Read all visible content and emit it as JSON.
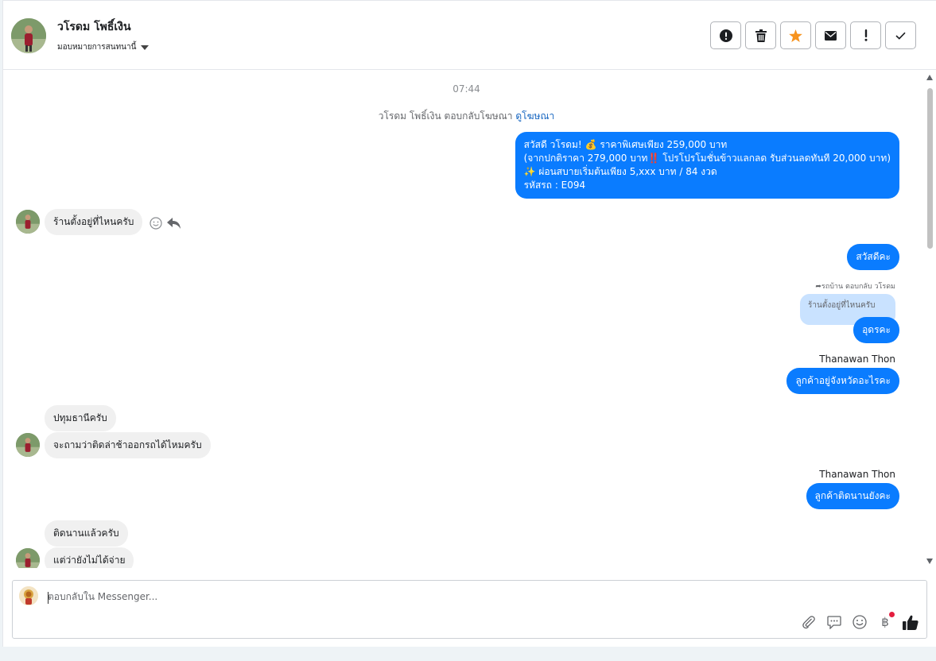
{
  "header": {
    "contact_name": "วโรดม โพธิ์เงิน",
    "assign_label": "มอบหมายการสนทนานี้"
  },
  "toolbar": {
    "buttons": [
      "alert-circle-icon",
      "trash-icon",
      "star-icon",
      "envelope-icon",
      "exclamation-icon",
      "checkmark-icon"
    ]
  },
  "chat": {
    "timestamp": "07:44",
    "ad_reply_text": "วโรดม โพธิ์เงิน ตอบกลับโฆษณา",
    "ad_reply_link": "ดูโฆษณา",
    "messages": [
      {
        "direction": "out",
        "lines": [
          "สวัสดี วโรดม! 💰 ราคาพิเศษเพียง 259,000 บาท",
          "(จากปกติราคา 279,000 บาท‼️ โปรโปรโมชั่นข้าวแลกลด รับส่วนลดทันที 20,000 บาท)",
          "✨ ผ่อนสบายเริ่มต้นเพียง 5,xxx บาท / 84 งวด",
          " รหัสรถ : E094"
        ]
      },
      {
        "direction": "in",
        "text": "ร้านตั้งอยู่ที่ไหนครับ"
      },
      {
        "direction": "out",
        "text": "สวัสดีคะ"
      },
      {
        "direction": "out",
        "reply_meta": "รถบ้าน ตอบกลับ วโรดม",
        "quoted": "ร้านตั้งอยู่ที่ไหนครับ",
        "text": "อุดรคะ"
      },
      {
        "direction": "out",
        "sender": "Thanawan Thon",
        "text": "ลูกค้าอยู่จังหวัดอะไรคะ"
      },
      {
        "direction": "in",
        "text": "ปทุมธานีครับ"
      },
      {
        "direction": "in",
        "text": "จะถามว่าติดล่าช้าออกรถได้ไหมครับ"
      },
      {
        "direction": "out",
        "sender": "Thanawan Thon",
        "text": "ลูกค้าติดนานยังคะ"
      },
      {
        "direction": "in",
        "text": "ติดนานแล้วครับ"
      },
      {
        "direction": "in",
        "text": "แต่ว่ายังไม่ได้จ่าย"
      }
    ]
  },
  "composer": {
    "placeholder": "ตอบกลับใน Messenger...",
    "tools": [
      "paperclip-icon",
      "chat-bubble-icon",
      "emoji-icon",
      "baht-icon",
      "thumbs-up-icon"
    ],
    "baht_symbol": "฿"
  },
  "colors": {
    "outgoing_bubble": "#0a7cff",
    "incoming_bubble": "#f0f0f0",
    "quoted_bubble": "#c9e2ff",
    "link": "#1565c0"
  }
}
